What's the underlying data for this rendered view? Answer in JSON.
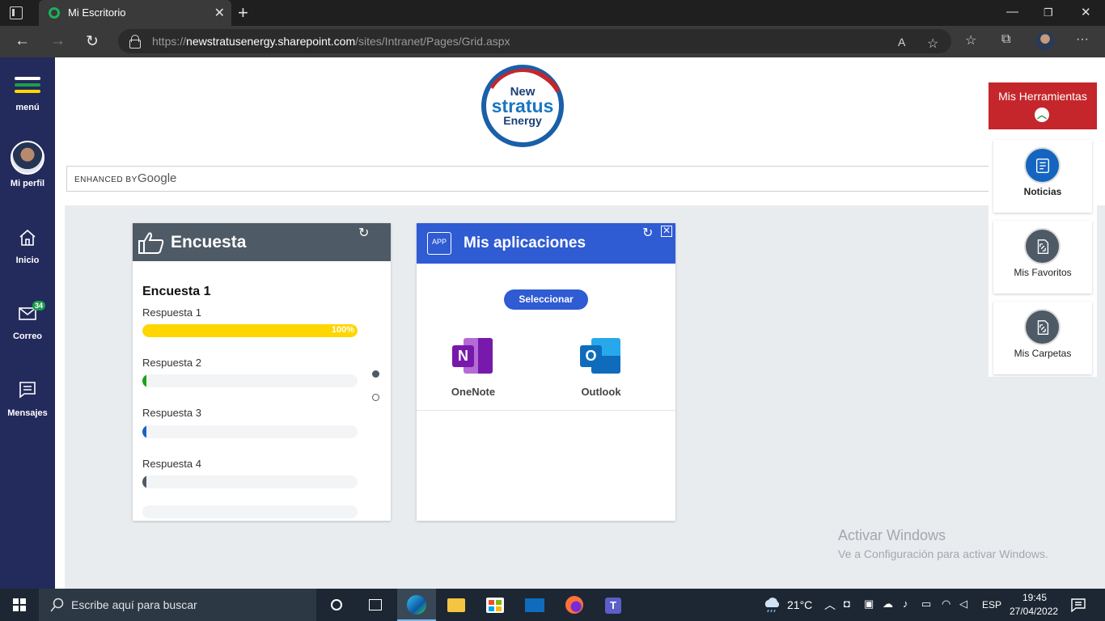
{
  "browser": {
    "tab_title": "Mi Escritorio",
    "url_prefix": "https://",
    "url_host": "newstratusenergy.sharepoint.com",
    "url_path": "/sites/Intranet/Pages/Grid.aspx"
  },
  "leftnav": {
    "menu_label": "menú",
    "profile_label": "Mi perfil",
    "home_label": "Inicio",
    "mail_label": "Correo",
    "mail_badge": "34",
    "messages_label": "Mensajes"
  },
  "logo": {
    "line1": "New",
    "line2": "stratus",
    "line3": "Energy"
  },
  "search": {
    "enhanced_label": "ENHANCED BY",
    "google_label": "Google"
  },
  "survey": {
    "title": "Encuesta",
    "question": "Encuesta 1",
    "answers": [
      {
        "label": "Respuesta 1",
        "percent": 100,
        "pct_label": "100%",
        "color": "#ffd600"
      },
      {
        "label": "Respuesta 2",
        "percent": 0,
        "color": "#1aa31a"
      },
      {
        "label": "Respuesta 3",
        "percent": 0,
        "color": "#1565c0"
      },
      {
        "label": "Respuesta 4",
        "percent": 0,
        "color": "#4e5a66"
      }
    ]
  },
  "apps": {
    "title": "Mis aplicaciones",
    "head_icon": "APP",
    "select_label": "Seleccionar",
    "items": [
      {
        "name": "OneNote",
        "letter": "N",
        "color": "#7719aa"
      },
      {
        "name": "Outlook",
        "letter": "O",
        "color": "#0f6cbd"
      }
    ]
  },
  "tools": {
    "title": "Mis Herramientas",
    "items": [
      {
        "label": "Noticias",
        "color": "#1565c0"
      },
      {
        "label": "Mis Favoritos",
        "color": "#4e5a66"
      },
      {
        "label": "Mis Carpetas",
        "color": "#4e5a66"
      }
    ]
  },
  "watermark": {
    "line1": "Activar Windows",
    "line2": "Ve a Configuración para activar Windows."
  },
  "taskbar": {
    "search_placeholder": "Escribe aquí para buscar",
    "temperature": "21°C",
    "language": "ESP",
    "time": "19:45",
    "date": "27/04/2022"
  },
  "colors": {
    "nav_bg": "#232a5c",
    "survey_head": "#4e5a66",
    "apps_head": "#2f5bd3",
    "tools_head": "#c4262c"
  }
}
